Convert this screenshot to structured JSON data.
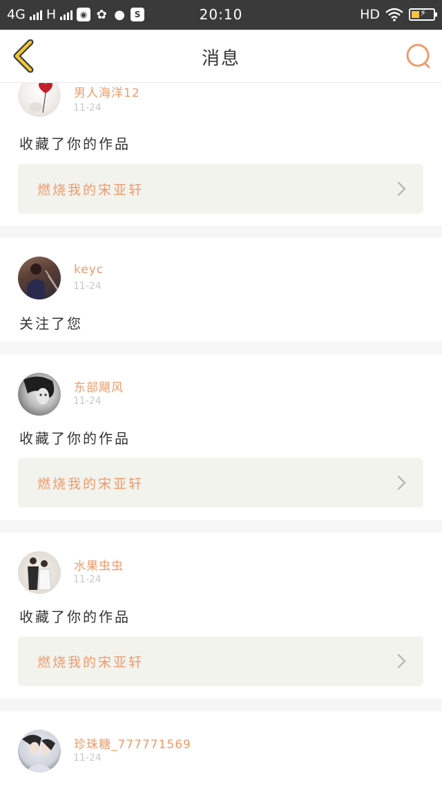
{
  "status_bar": {
    "network": "4G",
    "network2": "H",
    "time": "20:10",
    "hd": "HD"
  },
  "header": {
    "title": "消息"
  },
  "colors": {
    "accent": "#ef9a6a",
    "back_icon": "#f2c531",
    "card_bg": "#f3f3ee"
  },
  "messages": [
    {
      "user": "男人海洋12",
      "date": "11-24",
      "action": "收藏了你的作品",
      "work": "燃烧我的宋亚轩"
    },
    {
      "user": "keyc",
      "date": "11-24",
      "action": "关注了您"
    },
    {
      "user": "东部飓风",
      "date": "11-24",
      "action": "收藏了你的作品",
      "work": "燃烧我的宋亚轩"
    },
    {
      "user": "水果虫虫",
      "date": "11-24",
      "action": "收藏了你的作品",
      "work": "燃烧我的宋亚轩"
    },
    {
      "user": "珍珠糖_777771569",
      "date": "11-24"
    }
  ]
}
